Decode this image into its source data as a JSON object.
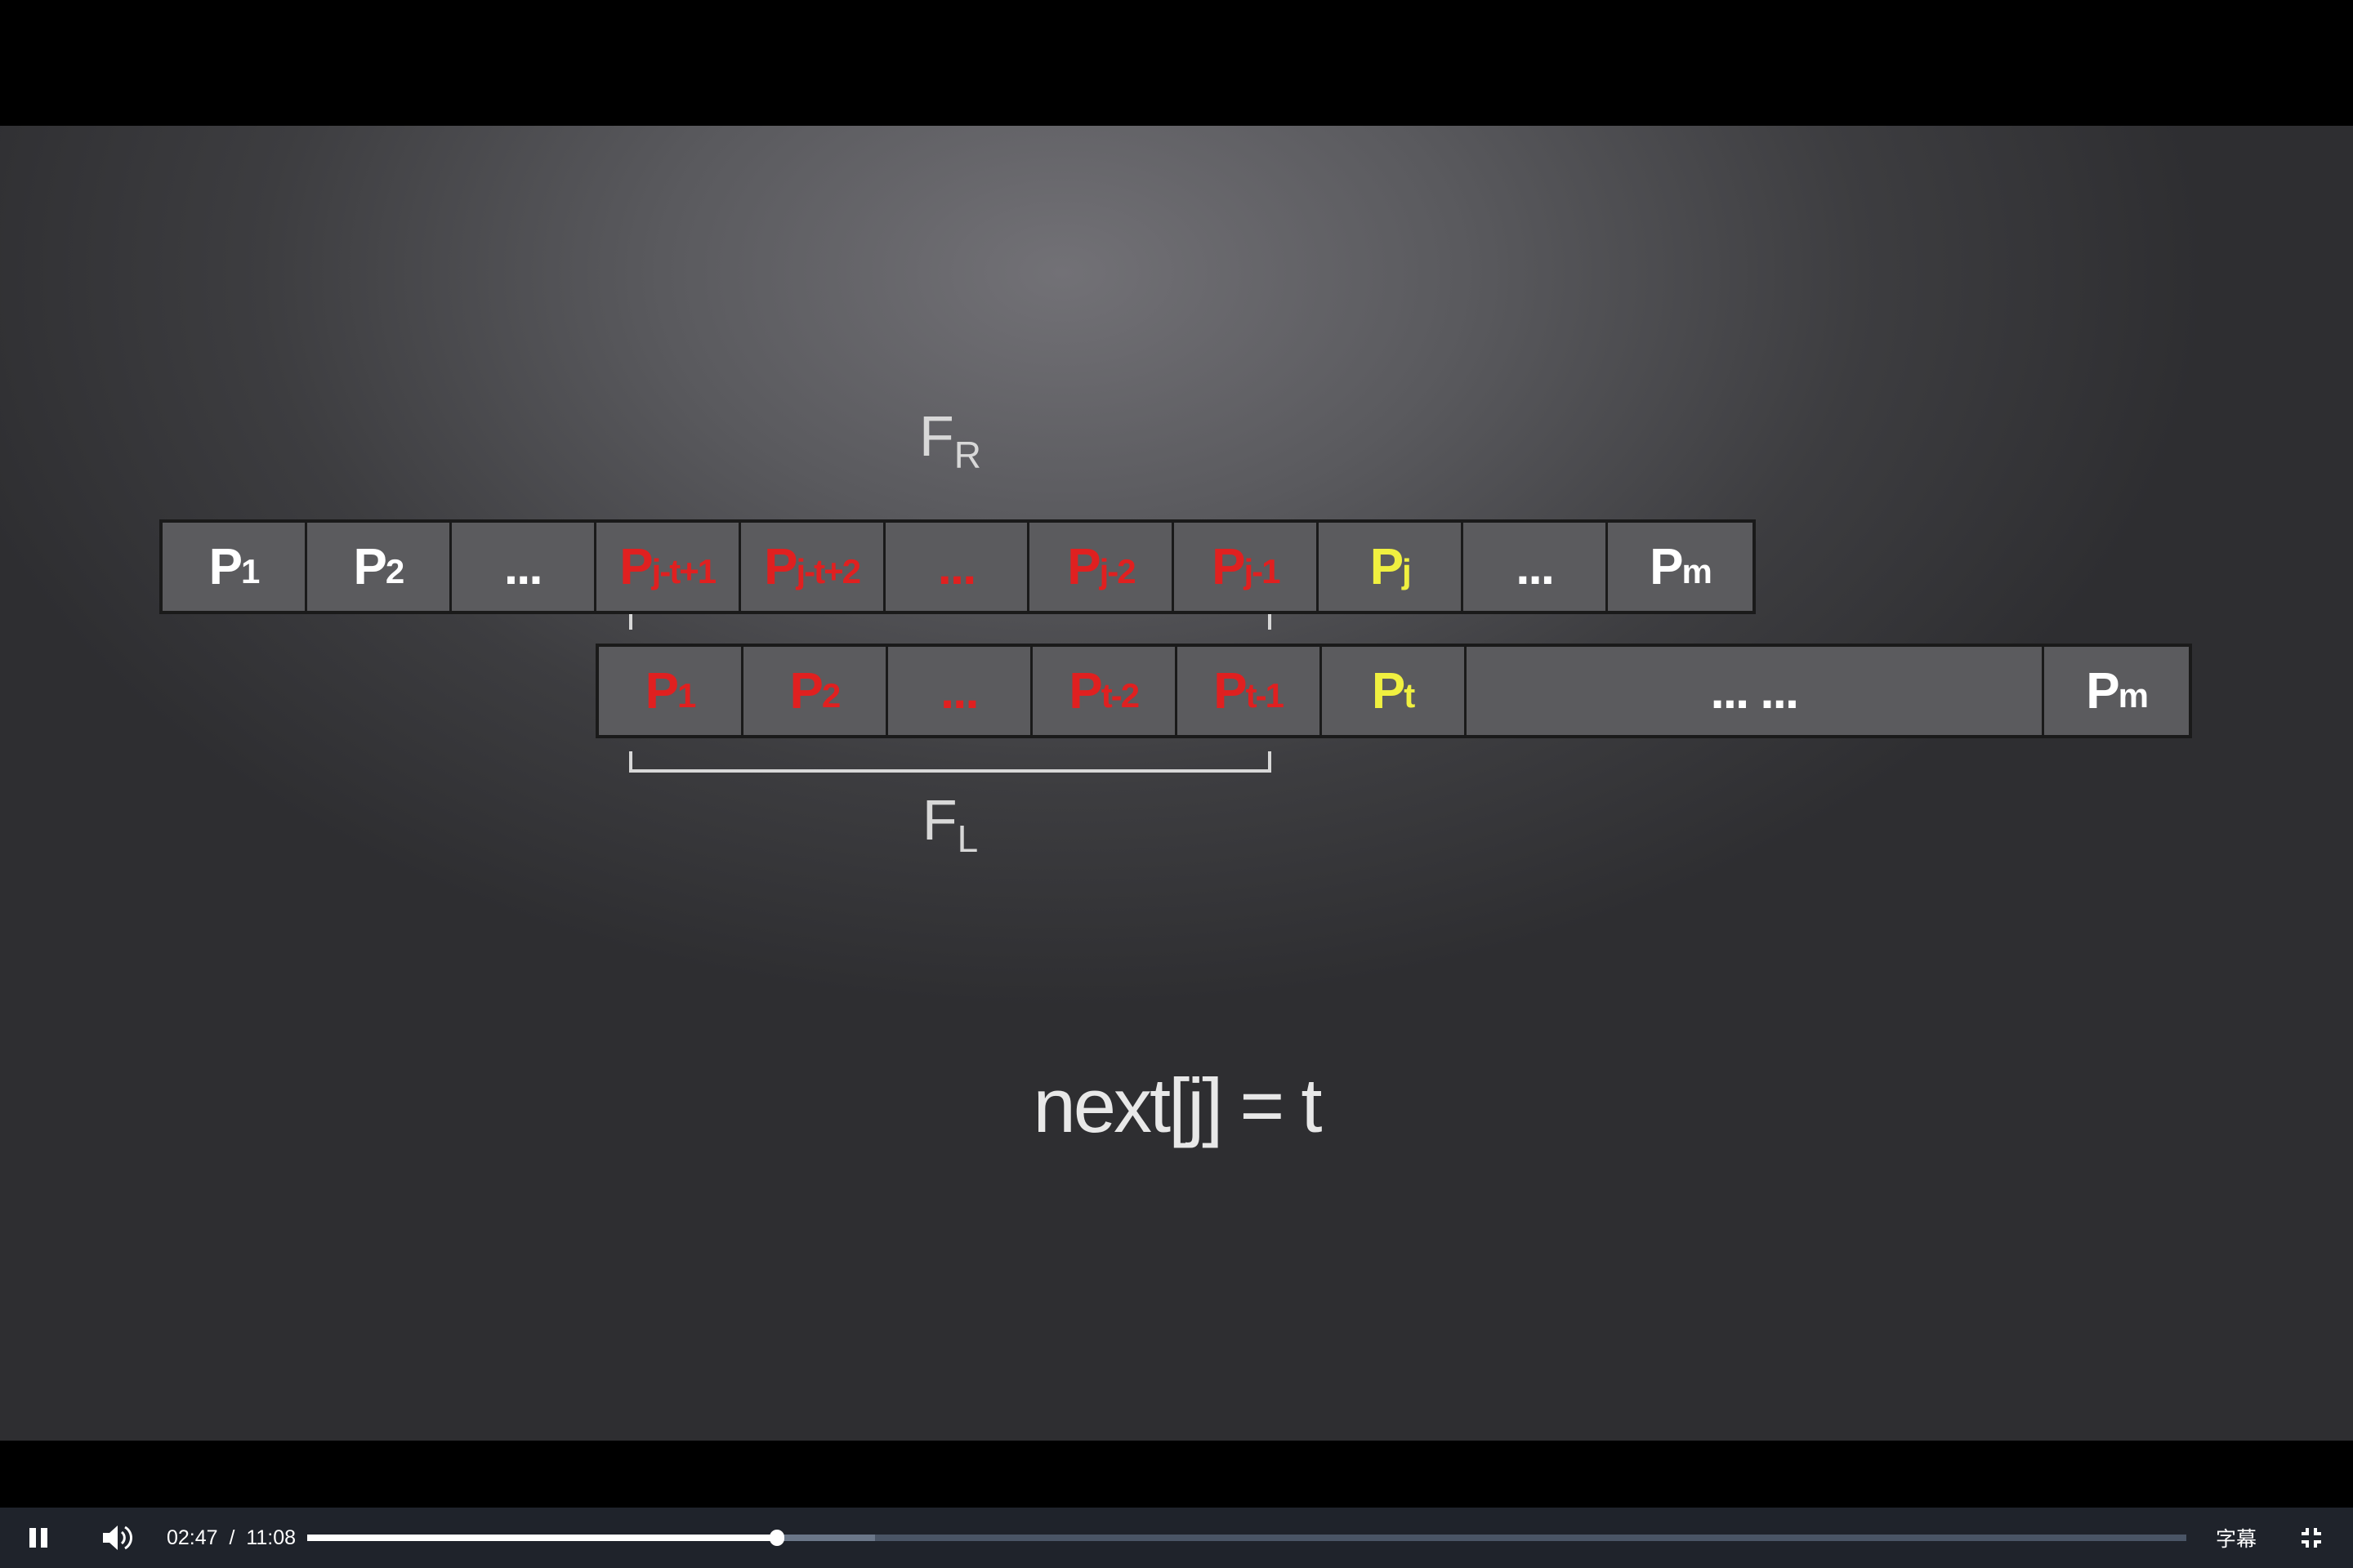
{
  "slide": {
    "row_top": [
      {
        "main": "P",
        "sub": "1",
        "color": "#ffffff"
      },
      {
        "main": "P",
        "sub": "2",
        "color": "#ffffff"
      },
      {
        "main": "...",
        "sub": "",
        "color": "#ffffff"
      },
      {
        "main": "P",
        "sub": "j-t+1",
        "color": "#e02020"
      },
      {
        "main": "P",
        "sub": "j-t+2",
        "color": "#e02020"
      },
      {
        "main": "...",
        "sub": "",
        "color": "#e02020"
      },
      {
        "main": "P",
        "sub": "j-2",
        "color": "#e02020"
      },
      {
        "main": "P",
        "sub": "j-1",
        "color": "#e02020"
      },
      {
        "main": "P",
        "sub": "j",
        "color": "#f0f040"
      },
      {
        "main": "...",
        "sub": "",
        "color": "#ffffff"
      },
      {
        "main": "P",
        "sub": "m",
        "color": "#ffffff"
      }
    ],
    "row_bottom": [
      {
        "main": "P",
        "sub": "1",
        "color": "#e02020"
      },
      {
        "main": "P",
        "sub": "2",
        "color": "#e02020"
      },
      {
        "main": "...",
        "sub": "",
        "color": "#e02020"
      },
      {
        "main": "P",
        "sub": "t-2",
        "color": "#e02020"
      },
      {
        "main": "P",
        "sub": "t-1",
        "color": "#e02020"
      },
      {
        "main": "P",
        "sub": "t",
        "color": "#f0f040"
      },
      {
        "main": "... ...",
        "sub": "",
        "color": "#ffffff",
        "wide": true
      },
      {
        "main": "P",
        "sub": "m",
        "color": "#ffffff"
      }
    ],
    "label_top": {
      "main": "F",
      "sub": "R"
    },
    "label_bottom": {
      "main": "F",
      "sub": "L"
    },
    "formula": "next[j] = t"
  },
  "player": {
    "current_time": "02:47",
    "separator": "/",
    "duration": "11:08",
    "progress": 0.25,
    "buffered": 0.302,
    "subtitles_label": "字幕",
    "icons": [
      "pause-icon",
      "volume-icon",
      "exit-fullscreen-icon"
    ]
  }
}
